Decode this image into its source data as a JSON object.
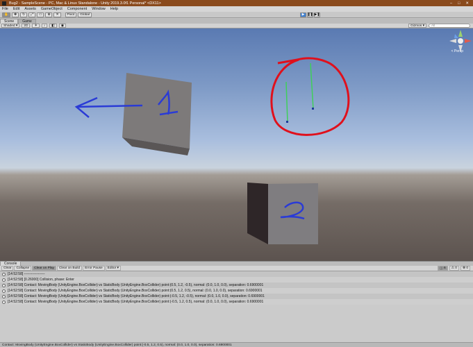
{
  "window": {
    "title": "Bug2 - SampleScene - PC, Mac & Linux Standalone - Unity 2019.3.0f1 Personal* <DX11>"
  },
  "menu": [
    "File",
    "Edit",
    "Assets",
    "GameObject",
    "Component",
    "Window",
    "Help"
  ],
  "toolbar": {
    "pivot_label": "Pivot",
    "global_label": "Global"
  },
  "tabs": {
    "scene": "Scene",
    "game": "Game"
  },
  "scene_toolbar": {
    "shading": "Shaded",
    "mode_2d": "2D",
    "gizmos": "Gizmos",
    "search_placeholder": "All"
  },
  "scene": {
    "persp_label": "< Persp",
    "annotation_1": "1",
    "annotation_2": "2",
    "colors": {
      "annotation_blue": "#2a3bd6",
      "annotation_red": "#e0101c",
      "collider_green": "#3fcf5a"
    }
  },
  "console": {
    "tab": "Console",
    "buttons": [
      "Clear",
      "Collapse",
      "Clear on Play",
      "Clear on Build",
      "Error Pause",
      "Editor ▾"
    ],
    "counts": [
      "6",
      "0",
      "0"
    ],
    "rows": [
      "[14:52:58] ------------------",
      "[14:52:58] [0.26000] Collision, phase: Enter",
      "[14:52:58] Contact: MovingBody (UnityEngine.BoxCollider) vs StaticBody (UnityEngine.BoxCollider) point:(0.5, 1.2, -0.5), normal: (0.0, 1.0, 0.0), separation: 0.6900001",
      "[14:52:58] Contact: MovingBody (UnityEngine.BoxCollider) vs StaticBody (UnityEngine.BoxCollider) point:(0.5, 1.2, 0.5), normal: (0.0, 1.0, 0.0), separation: 0.6900001",
      "[14:52:58] Contact: MovingBody (UnityEngine.BoxCollider) vs StaticBody (UnityEngine.BoxCollider) point:(-0.5, 1.2, -0.5), normal: (0.0, 1.0, 0.0), separation: 0.6900001",
      "[14:52:58] Contact: MovingBody (UnityEngine.BoxCollider) vs StaticBody (UnityEngine.BoxCollider) point:(-0.5, 1.2, 0.5), normal: (0.0, 1.0, 0.0), separation: 0.6900001"
    ]
  },
  "status": "Contact: MovingBody (UnityEngine.BoxCollider) vs StaticBody (UnityEngine.BoxCollider) point:(-0.5, 1.2, 0.5), normal: (0.0, 1.0, 0.0), separation: 0.6900001"
}
